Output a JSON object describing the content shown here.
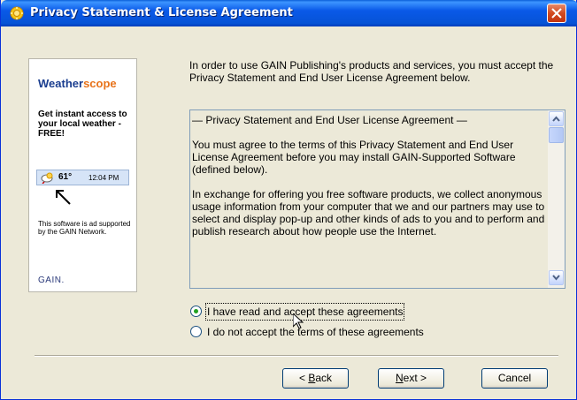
{
  "window": {
    "title": "Privacy Statement & License Agreement",
    "title_icon": "gear-sun-icon",
    "close_icon": "close-icon",
    "accent_color": "#0a59e8"
  },
  "ad": {
    "brand_part1": "Weather",
    "brand_part2": "scope",
    "headline": "Get instant access to your local weather - FREE!",
    "tray_temp": "61°",
    "tray_time": "12:04 PM",
    "note": "This software is ad supported by the GAIN Network.",
    "logo": "GAIN."
  },
  "intro": "In order to use GAIN Publishing's products and services, you must accept the Privacy Statement and End User License Agreement below.",
  "terms": {
    "heading": "— Privacy Statement and End User License Agreement —",
    "paragraph1": "You must agree to the terms of this Privacy Statement and End User License Agreement before you may install GAIN-Supported Software (defined below).",
    "paragraph2": "In exchange for offering you free software products, we collect anonymous usage information from your computer that we and our partners may use to select and display pop-up and other kinds of ads to you and to perform and publish research about how people use the Internet."
  },
  "options": {
    "accept_label": "I have read and accept these agreements",
    "decline_label": "I do not accept the terms of these agreements",
    "selected": "accept"
  },
  "buttons": {
    "back_prefix": "< ",
    "back_access": "B",
    "back_rest": "ack",
    "next_access": "N",
    "next_rest": "ext >",
    "cancel": "Cancel"
  }
}
